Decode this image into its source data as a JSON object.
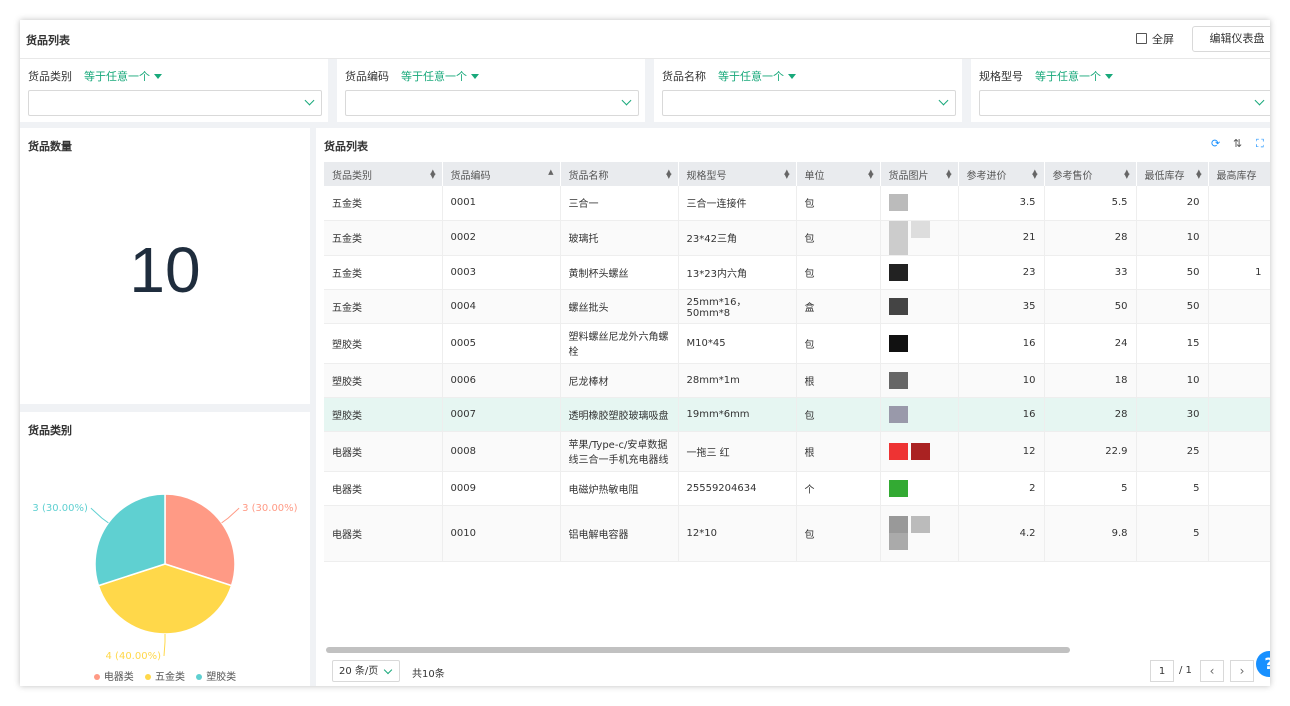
{
  "header": {
    "title": "货品列表",
    "fullscreen_label": "全屏",
    "edit_label": "编辑仪表盘"
  },
  "filters": [
    {
      "label": "货品类别",
      "operator": "等于任意一个"
    },
    {
      "label": "货品编码",
      "operator": "等于任意一个"
    },
    {
      "label": "货品名称",
      "operator": "等于任意一个"
    },
    {
      "label": "规格型号",
      "operator": "等于任意一个"
    }
  ],
  "count_card": {
    "title": "货品数量",
    "value": "10"
  },
  "category_card": {
    "title": "货品类别",
    "slices": [
      {
        "name": "电器类",
        "value": 3,
        "label": "3 (30.00%)",
        "color": "#ff9a85"
      },
      {
        "name": "五金类",
        "value": 4,
        "label": "4 (40.00%)",
        "color": "#ffd84a"
      },
      {
        "name": "塑胶类",
        "value": 3,
        "label": "3 (30.00%)",
        "color": "#5fd0d1"
      }
    ]
  },
  "table": {
    "title": "货品列表",
    "columns": [
      "货品类别",
      "货品编码",
      "货品名称",
      "规格型号",
      "单位",
      "货品图片",
      "参考进价",
      "参考售价",
      "最低库存",
      "最高库存"
    ],
    "rows": [
      {
        "cat": "五金类",
        "code": "0001",
        "name": "三合一",
        "spec": "三合一连接件",
        "unit": "包",
        "cost": "3.5",
        "price": "5.5",
        "min": "20",
        "max": ""
      },
      {
        "cat": "五金类",
        "code": "0002",
        "name": "玻璃托",
        "spec": "23*42三角",
        "unit": "包",
        "cost": "21",
        "price": "28",
        "min": "10",
        "max": ""
      },
      {
        "cat": "五金类",
        "code": "0003",
        "name": "黄制杯头螺丝",
        "spec": "13*23内六角",
        "unit": "包",
        "cost": "23",
        "price": "33",
        "min": "50",
        "max": "1"
      },
      {
        "cat": "五金类",
        "code": "0004",
        "name": "螺丝批头",
        "spec": "25mm*16，50mm*8",
        "unit": "盒",
        "cost": "35",
        "price": "50",
        "min": "50",
        "max": ""
      },
      {
        "cat": "塑胶类",
        "code": "0005",
        "name": "塑料螺丝尼龙外六角螺栓",
        "spec": "M10*45",
        "unit": "包",
        "cost": "16",
        "price": "24",
        "min": "15",
        "max": ""
      },
      {
        "cat": "塑胶类",
        "code": "0006",
        "name": "尼龙棒材",
        "spec": "28mm*1m",
        "unit": "根",
        "cost": "10",
        "price": "18",
        "min": "10",
        "max": ""
      },
      {
        "cat": "塑胶类",
        "code": "0007",
        "name": "透明橡胶塑胶玻璃吸盘",
        "spec": "19mm*6mm",
        "unit": "包",
        "cost": "16",
        "price": "28",
        "min": "30",
        "max": ""
      },
      {
        "cat": "电器类",
        "code": "0008",
        "name": "苹果/Type-c/安卓数据线三合一手机充电器线",
        "spec": "一拖三 红",
        "unit": "根",
        "cost": "12",
        "price": "22.9",
        "min": "25",
        "max": ""
      },
      {
        "cat": "电器类",
        "code": "0009",
        "name": "电磁炉热敏电阻",
        "spec": "25559204634",
        "unit": "个",
        "cost": "2",
        "price": "5",
        "min": "5",
        "max": ""
      },
      {
        "cat": "电器类",
        "code": "0010",
        "name": "铝电解电容器",
        "spec": "12*10",
        "unit": "包",
        "cost": "4.2",
        "price": "9.8",
        "min": "5",
        "max": ""
      }
    ]
  },
  "pager": {
    "page_size": "20 条/页",
    "total": "共10条",
    "page": "1",
    "of": "/ 1"
  }
}
